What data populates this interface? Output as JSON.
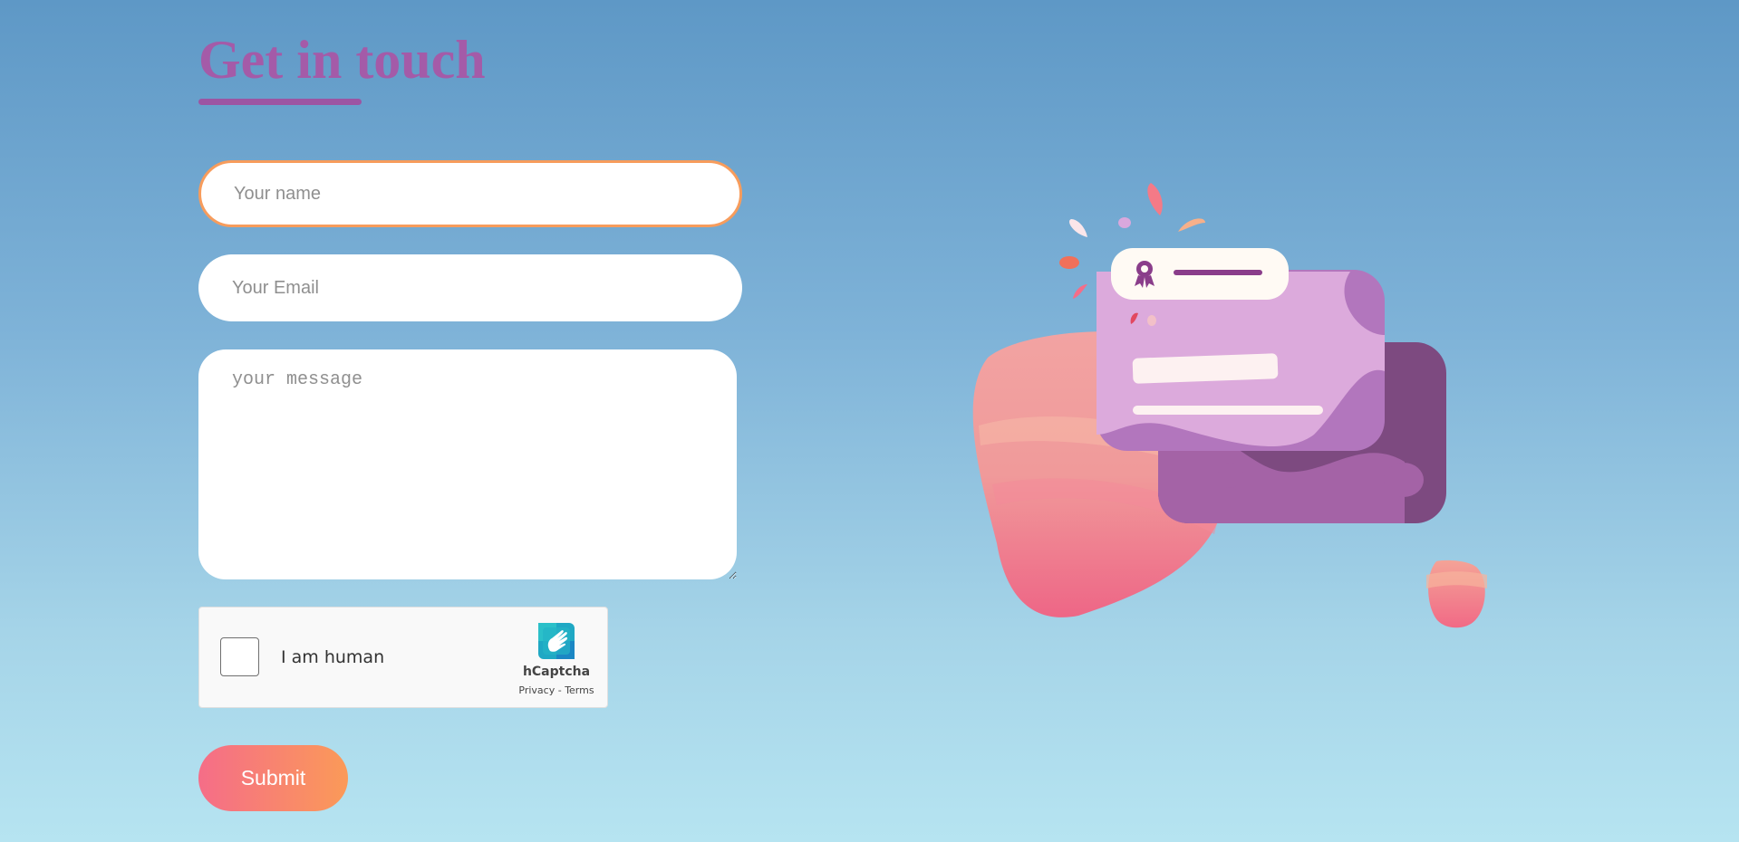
{
  "page": {
    "title": "Get in touch"
  },
  "form": {
    "name_placeholder": "Your name",
    "email_placeholder": "Your Email",
    "message_placeholder": "your message",
    "submit_label": "Submit"
  },
  "captcha": {
    "label": "I am human",
    "brand": "hCaptcha",
    "privacy_link": "Privacy",
    "separator": " - ",
    "terms_link": "Terms"
  },
  "icons": {
    "captcha_logo": "hand-icon",
    "badge": "award-ribbon-icon"
  },
  "colors": {
    "title": "#a45ba8",
    "focus_border": "#f79c5c",
    "submit_start": "#f56d88",
    "submit_end": "#fb9a58"
  }
}
